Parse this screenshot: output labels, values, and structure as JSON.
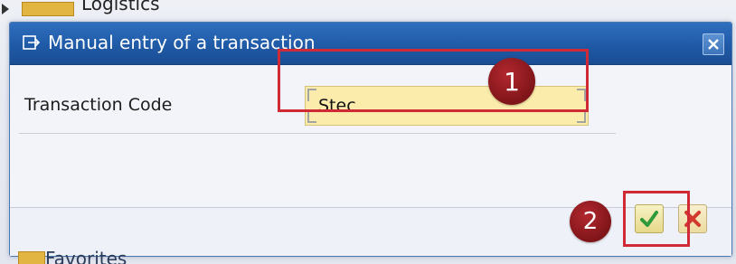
{
  "background": {
    "tree_top_label": "Logistics",
    "tree_bottom_label": "Favorites"
  },
  "dialog": {
    "title": "Manual entry of a transaction",
    "title_icon": "keyboard-entry-icon",
    "close_icon": "close-icon"
  },
  "form": {
    "field_label": "Transaction Code",
    "field_value": "Stec"
  },
  "annotations": {
    "step1": "1",
    "step2": "2",
    "highlight_color": "#d02a36",
    "badge_color": "#8e1a1f"
  },
  "footer": {
    "ok_icon": "checkmark-icon",
    "cancel_icon": "cancel-icon"
  },
  "colors": {
    "titlebar": "#1f5aa6",
    "input_background": "#fcecab"
  }
}
